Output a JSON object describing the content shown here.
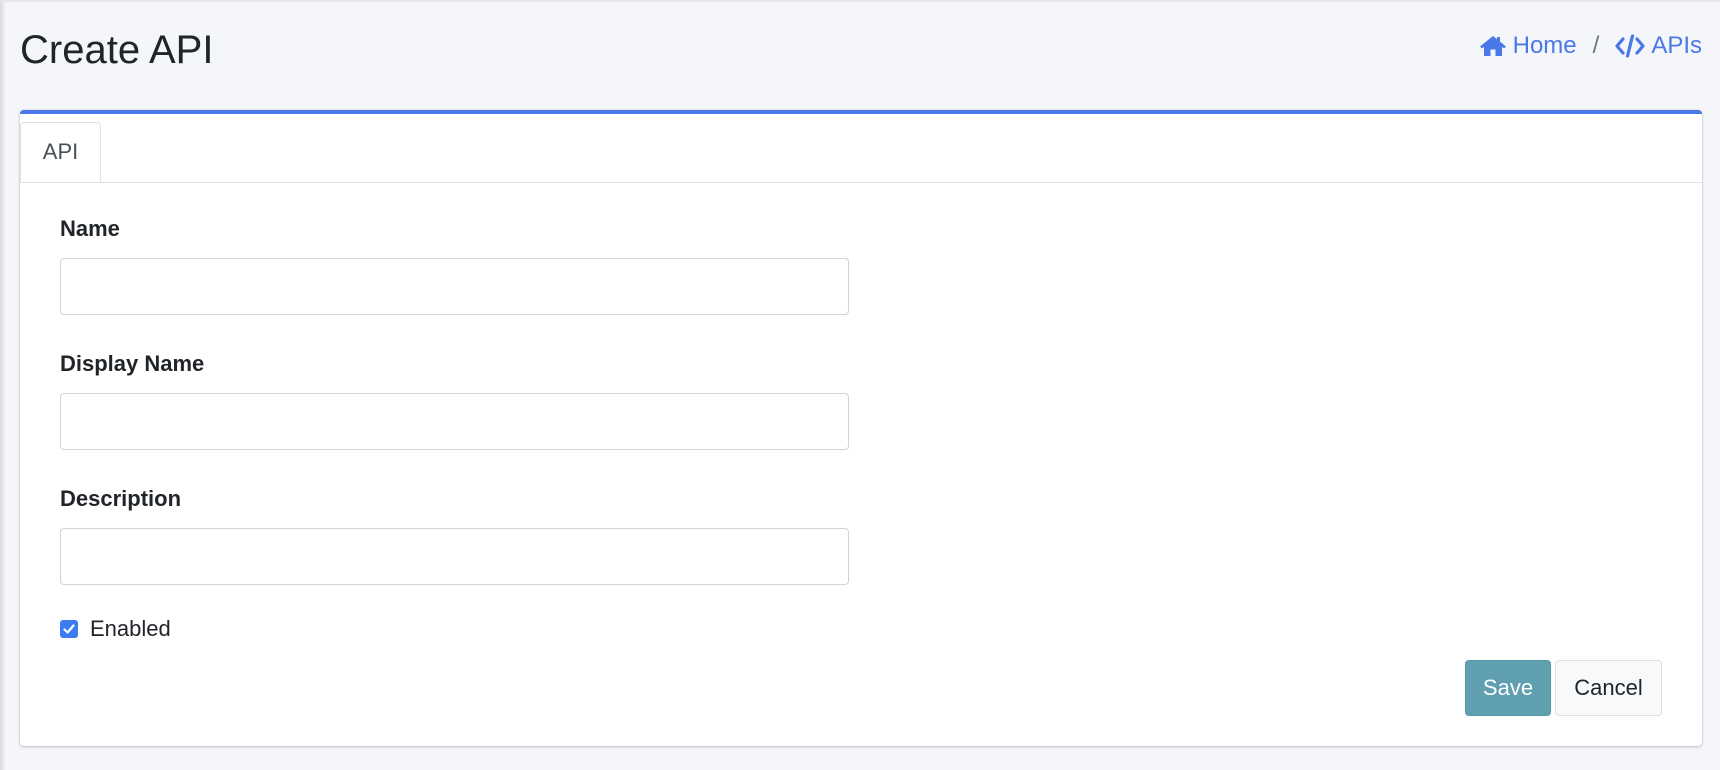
{
  "page": {
    "title": "Create API"
  },
  "breadcrumb": {
    "home_label": "Home",
    "home_icon": "home-icon",
    "separator": "/",
    "apis_label": "APIs",
    "apis_icon": "code-icon"
  },
  "tabs": [
    {
      "label": "API",
      "active": true
    }
  ],
  "form": {
    "name": {
      "label": "Name",
      "value": "",
      "placeholder": ""
    },
    "display_name": {
      "label": "Display Name",
      "value": "",
      "placeholder": ""
    },
    "description": {
      "label": "Description",
      "value": "",
      "placeholder": ""
    },
    "enabled": {
      "label": "Enabled",
      "checked": true
    }
  },
  "actions": {
    "save_label": "Save",
    "cancel_label": "Cancel"
  },
  "colors": {
    "accent": "#4a78e8",
    "save_button": "#5f9faf",
    "checkbox": "#3b7df0",
    "background": "#f4f6f9"
  }
}
